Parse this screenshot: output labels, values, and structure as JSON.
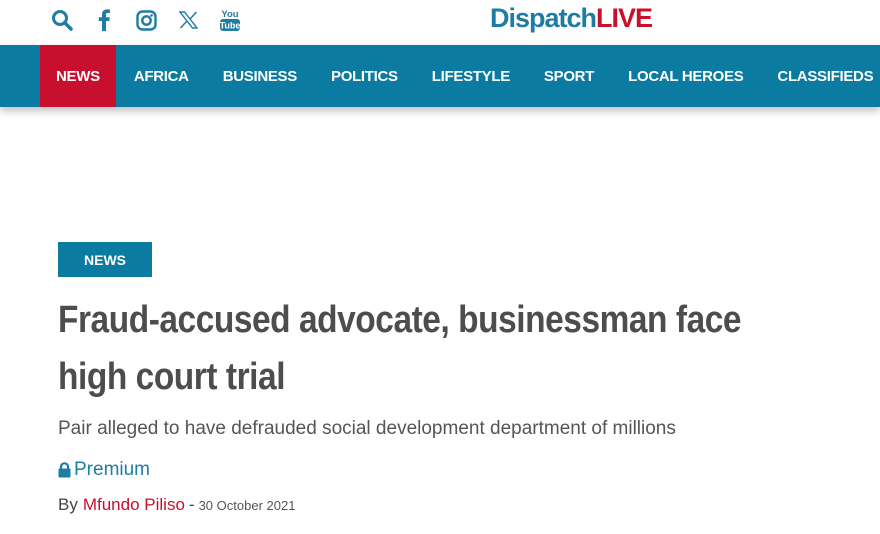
{
  "header": {
    "logo_part1": "Dispatch",
    "logo_part2": "LIVE",
    "social_icons": [
      "search-icon",
      "facebook-icon",
      "instagram-icon",
      "x-icon",
      "youtube-icon"
    ],
    "youtube_text_top": "You",
    "youtube_text_bottom": "Tube"
  },
  "nav": {
    "items": [
      {
        "label": "NEWS",
        "active": true
      },
      {
        "label": "AFRICA"
      },
      {
        "label": "BUSINESS"
      },
      {
        "label": "POLITICS"
      },
      {
        "label": "LIFESTYLE"
      },
      {
        "label": "SPORT"
      },
      {
        "label": "LOCAL HEROES"
      },
      {
        "label": "CLASSIFIEDS"
      }
    ]
  },
  "article": {
    "tag": "NEWS",
    "headline": "Fraud-accused advocate, businessman face high court trial",
    "standfirst": "Pair alleged to have defrauded social development department of millions",
    "premium_label": "Premium",
    "by": "By",
    "author": "Mfundo Piliso",
    "dash": "-",
    "date": "30 October 2021"
  },
  "colors": {
    "brand_blue": "#0c7ba1",
    "brand_red": "#c8102e",
    "headline_gray": "#4d4d4d"
  }
}
